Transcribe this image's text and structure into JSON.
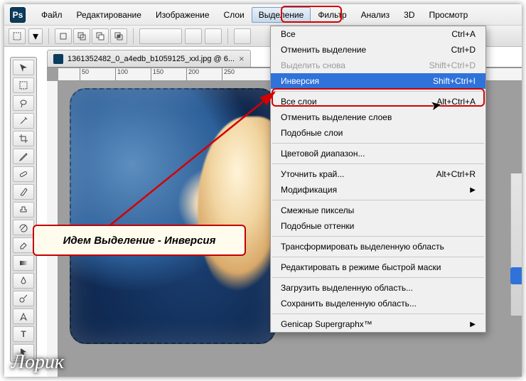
{
  "app": {
    "logo_text": "Ps"
  },
  "menubar": {
    "items": [
      {
        "label": "Файл"
      },
      {
        "label": "Редактирование"
      },
      {
        "label": "Изображение"
      },
      {
        "label": "Слои"
      },
      {
        "label": "Выделение",
        "open": true
      },
      {
        "label": "Фильтр"
      },
      {
        "label": "Анализ"
      },
      {
        "label": "3D"
      },
      {
        "label": "Просмотр"
      }
    ]
  },
  "document": {
    "tab_title": "1361352482_0_a4edb_b1059125_xxl.jpg @ 6...",
    "close_glyph": "×"
  },
  "ruler_ticks": [
    "50",
    "100",
    "150",
    "200",
    "250"
  ],
  "dropdown": {
    "rows": [
      {
        "label": "Все",
        "shortcut": "Ctrl+A",
        "type": "item"
      },
      {
        "label": "Отменить выделение",
        "shortcut": "Ctrl+D",
        "type": "item"
      },
      {
        "label": "Выделить снова",
        "shortcut": "Shift+Ctrl+D",
        "type": "item",
        "disabled": true
      },
      {
        "label": "Инверсия",
        "shortcut": "Shift+Ctrl+I",
        "type": "item",
        "highlight": true
      },
      {
        "type": "sep"
      },
      {
        "label": "Все слои",
        "shortcut": "Alt+Ctrl+A",
        "type": "item"
      },
      {
        "label": "Отменить выделение слоев",
        "shortcut": "",
        "type": "item"
      },
      {
        "label": "Подобные слои",
        "shortcut": "",
        "type": "item"
      },
      {
        "type": "sep"
      },
      {
        "label": "Цветовой диапазон...",
        "shortcut": "",
        "type": "item"
      },
      {
        "type": "sep"
      },
      {
        "label": "Уточнить край...",
        "shortcut": "Alt+Ctrl+R",
        "type": "item"
      },
      {
        "label": "Модификация",
        "shortcut": "",
        "type": "submenu"
      },
      {
        "type": "sep"
      },
      {
        "label": "Смежные пикселы",
        "shortcut": "",
        "type": "item"
      },
      {
        "label": "Подобные оттенки",
        "shortcut": "",
        "type": "item"
      },
      {
        "type": "sep"
      },
      {
        "label": "Трансформировать выделенную область",
        "shortcut": "",
        "type": "item"
      },
      {
        "type": "sep"
      },
      {
        "label": "Редактировать в режиме быстрой маски",
        "shortcut": "",
        "type": "item"
      },
      {
        "type": "sep"
      },
      {
        "label": "Загрузить выделенную область...",
        "shortcut": "",
        "type": "item"
      },
      {
        "label": "Сохранить выделенную область...",
        "shortcut": "",
        "type": "item"
      },
      {
        "type": "sep"
      },
      {
        "label": "Genicap Supergraphx™",
        "shortcut": "",
        "type": "submenu"
      }
    ]
  },
  "hint": {
    "text": "Идем Выделение - Инверсия"
  },
  "watermark": {
    "text": "Лорик"
  },
  "colors": {
    "accent": "#2f72da",
    "callout": "#c40000"
  }
}
